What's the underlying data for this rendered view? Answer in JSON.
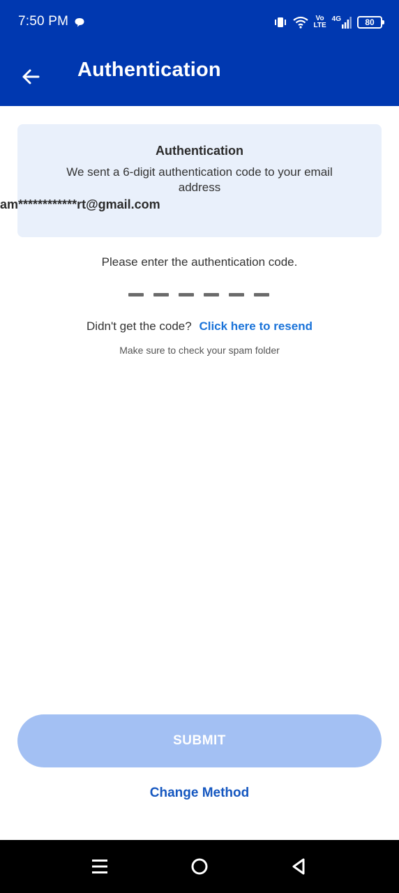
{
  "status_bar": {
    "time": "7:50 PM",
    "network_top": "Vo",
    "network_bottom": "LTE",
    "network_type": "4G",
    "battery": "80",
    "icons": [
      "chat-icon",
      "vibrate-icon",
      "wifi-icon",
      "volte-icon",
      "signal-icon",
      "battery-icon"
    ]
  },
  "header": {
    "title": "Authentication",
    "back_icon": "arrow-left-icon",
    "background_color": "#0038b0"
  },
  "info_card": {
    "title": "Authentication",
    "message": "We sent a 6-digit authentication code to your email address",
    "email": "am************rt@gmail.com"
  },
  "prompt": "Please enter the authentication code.",
  "code_slots": 6,
  "resend": {
    "question": "Didn't get the code?",
    "link": "Click here to resend"
  },
  "spam_hint": "Make sure to check your spam folder",
  "submit_label": "SUBMIT",
  "change_method_label": "Change Method",
  "nav_bar": {
    "icons": [
      "menu-icon",
      "home-icon",
      "back-triangle-icon"
    ]
  },
  "colors": {
    "accent": "#1a73d9",
    "submit_disabled": "#a3c0f3",
    "info_card_bg": "#e9f0fb"
  }
}
